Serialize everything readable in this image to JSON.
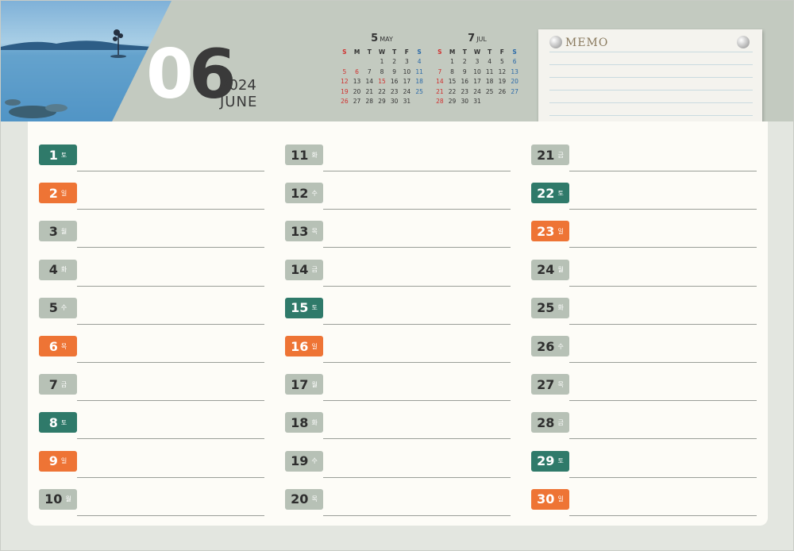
{
  "header": {
    "month_digit_0": "0",
    "month_digit_1": "6",
    "year": "2024",
    "month_name": "JUNE"
  },
  "mini_calendars": [
    {
      "num": "5",
      "name": "MAY",
      "dow": [
        "S",
        "M",
        "T",
        "W",
        "T",
        "F",
        "S"
      ],
      "weeks": [
        [
          "",
          "",
          "",
          "1",
          "2",
          "3",
          "4"
        ],
        [
          "5",
          "6",
          "7",
          "8",
          "9",
          "10",
          "11"
        ],
        [
          "12",
          "13",
          "14",
          "15",
          "16",
          "17",
          "18"
        ],
        [
          "19",
          "20",
          "21",
          "22",
          "23",
          "24",
          "25"
        ],
        [
          "26",
          "27",
          "28",
          "29",
          "30",
          "31",
          ""
        ]
      ],
      "red_dates": [
        "5",
        "6",
        "15"
      ]
    },
    {
      "num": "7",
      "name": "JUL",
      "dow": [
        "S",
        "M",
        "T",
        "W",
        "T",
        "F",
        "S"
      ],
      "weeks": [
        [
          "",
          "1",
          "2",
          "3",
          "4",
          "5",
          "6"
        ],
        [
          "7",
          "8",
          "9",
          "10",
          "11",
          "12",
          "13"
        ],
        [
          "14",
          "15",
          "16",
          "17",
          "18",
          "19",
          "20"
        ],
        [
          "21",
          "22",
          "23",
          "24",
          "25",
          "26",
          "27"
        ],
        [
          "28",
          "29",
          "30",
          "31",
          "",
          "",
          ""
        ]
      ],
      "red_dates": []
    }
  ],
  "memo": {
    "title": "MEMO"
  },
  "days": [
    {
      "d": "1",
      "w": "토",
      "t": "sat"
    },
    {
      "d": "2",
      "w": "일",
      "t": "sun"
    },
    {
      "d": "3",
      "w": "월",
      "t": "weekday"
    },
    {
      "d": "4",
      "w": "화",
      "t": "weekday"
    },
    {
      "d": "5",
      "w": "수",
      "t": "weekday"
    },
    {
      "d": "6",
      "w": "목",
      "t": "sun"
    },
    {
      "d": "7",
      "w": "금",
      "t": "weekday"
    },
    {
      "d": "8",
      "w": "토",
      "t": "sat"
    },
    {
      "d": "9",
      "w": "일",
      "t": "sun"
    },
    {
      "d": "10",
      "w": "월",
      "t": "weekday"
    },
    {
      "d": "11",
      "w": "화",
      "t": "weekday"
    },
    {
      "d": "12",
      "w": "수",
      "t": "weekday"
    },
    {
      "d": "13",
      "w": "목",
      "t": "weekday"
    },
    {
      "d": "14",
      "w": "금",
      "t": "weekday"
    },
    {
      "d": "15",
      "w": "토",
      "t": "sat"
    },
    {
      "d": "16",
      "w": "일",
      "t": "sun"
    },
    {
      "d": "17",
      "w": "월",
      "t": "weekday"
    },
    {
      "d": "18",
      "w": "화",
      "t": "weekday"
    },
    {
      "d": "19",
      "w": "수",
      "t": "weekday"
    },
    {
      "d": "20",
      "w": "목",
      "t": "weekday"
    },
    {
      "d": "21",
      "w": "금",
      "t": "weekday"
    },
    {
      "d": "22",
      "w": "토",
      "t": "sat"
    },
    {
      "d": "23",
      "w": "일",
      "t": "sun"
    },
    {
      "d": "24",
      "w": "월",
      "t": "weekday"
    },
    {
      "d": "25",
      "w": "화",
      "t": "weekday"
    },
    {
      "d": "26",
      "w": "수",
      "t": "weekday"
    },
    {
      "d": "27",
      "w": "목",
      "t": "weekday"
    },
    {
      "d": "28",
      "w": "금",
      "t": "weekday"
    },
    {
      "d": "29",
      "w": "토",
      "t": "sat"
    },
    {
      "d": "30",
      "w": "일",
      "t": "sun"
    }
  ],
  "colors": {
    "saturday": "#2f7a6a",
    "holiday": "#ee7435",
    "weekday": "#b7c1b6",
    "header": "#c3cac0"
  }
}
